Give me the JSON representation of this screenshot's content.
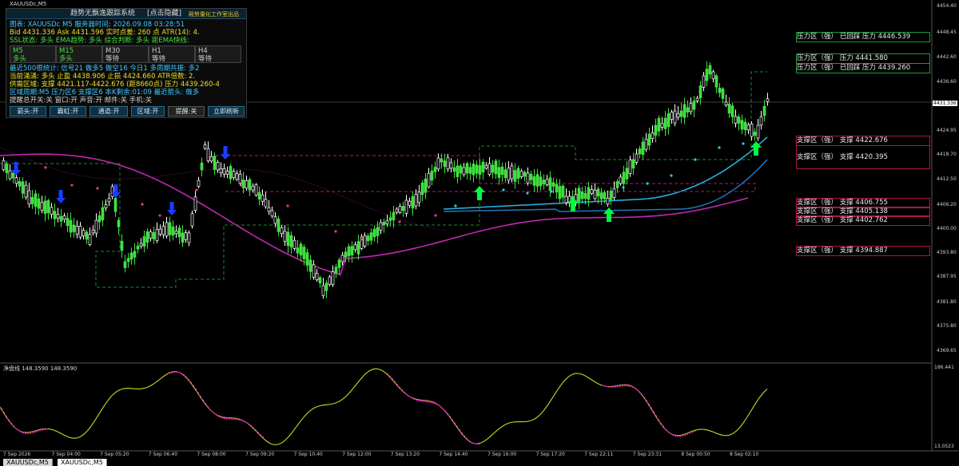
{
  "window": {
    "title": "XAUUSDc,M5"
  },
  "panel": {
    "title": "趋势无飘逸跟踪系统",
    "toggle": "[点击隐藏]",
    "brand": "殿势量化工作室出品",
    "lines": [
      {
        "text": "图表: XAUUSDc  M5   服务器时间: 2026.09.08 03:28:51",
        "color": "#3cc8ff"
      },
      {
        "text": "Bid 4431.336    Ask 4431.596    实时点差: 260 点    ATR(14): 4.",
        "color": "#e8e020"
      },
      {
        "text": "SSL状态: 多头    EMA趋势: 多头    综合判断: 多头    距EMA快线:",
        "color": "#40e040"
      }
    ],
    "timeframes": [
      {
        "name": "M5",
        "state": "多头",
        "color": "#40e040"
      },
      {
        "name": "M15",
        "state": "多头",
        "color": "#40e040"
      },
      {
        "name": "M30",
        "state": "等待",
        "color": "#d0d0d0"
      },
      {
        "name": "H1",
        "state": "等待",
        "color": "#d0d0d0"
      },
      {
        "name": "H4",
        "state": "等待",
        "color": "#d0d0d0"
      }
    ],
    "stats": [
      {
        "text": "最近500根统计: 信号21  做多5  做空16  今日1    多周期共振: 多2",
        "color": "#3cc8ff"
      },
      {
        "text": "当前涌涌: 多头    止盈 4438.906    止损 4424.660    ATR倍数: 2.",
        "color": "#e8e020"
      },
      {
        "text": "供需区域: 支撑 4421.117-4422.676  (距8660点)       压力 4439.260-4",
        "color": "#e8e020"
      },
      {
        "text": "区域周期:M5  压力区6  支撑区6  本K剩余:01:09    最近箭头: 做多",
        "color": "#3cc8ff"
      },
      {
        "text": "提醒总开关:关  窗口:开  声音:开  邮件:关  手机:关",
        "color": "#d0d0d0"
      }
    ],
    "buttons": [
      "箭头:开",
      "霸虹:开",
      "通道:开",
      "区域:开",
      "提醒:关",
      "立即刷新"
    ]
  },
  "zones": [
    {
      "label": "压力区（强）  已回踩    压力 4446.539",
      "type": "resistance"
    },
    {
      "label": "压力区（强）    压力 4441.580",
      "type": "resistance"
    },
    {
      "label": "压力区（强）  已回踩    压力 4439.260",
      "type": "resistance"
    },
    {
      "label": "支撑区（强）    支撑 4422.676",
      "type": "support"
    },
    {
      "label": "支撑区（强）    支撑 4420.395",
      "type": "support"
    },
    {
      "label": "支撑区（强）    支撑 4406.755",
      "type": "support"
    },
    {
      "label": "支撑区（强）    支撑 4405.138",
      "type": "support"
    },
    {
      "label": "支撑区（强）    支撑 4402.762",
      "type": "support"
    },
    {
      "label": "支撑区（强）    支撑 4394.887",
      "type": "support"
    }
  ],
  "price_axis": [
    "4454.40",
    "4448.45",
    "4442.60",
    "4436.60",
    "4431.336",
    "4424.95",
    "4418.70",
    "4412.50",
    "4406.20",
    "4400.00",
    "4393.80",
    "4387.95",
    "4381.80",
    "4375.80",
    "4369.65"
  ],
  "time_axis": [
    "7 Sep 2026",
    "7 Sep 04:00",
    "7 Sep 05:20",
    "7 Sep 06:40",
    "7 Sep 08:00",
    "7 Sep 09:20",
    "7 Sep 10:40",
    "7 Sep 12:00",
    "7 Sep 13:20",
    "7 Sep 14:40",
    "7 Sep 16:00",
    "7 Sep 17:20",
    "7 Sep 22:11",
    "7 Sep 23:31",
    "8 Sep 00:50",
    "8 Sep 02:10"
  ],
  "indicator": {
    "label": "净盘线 148.3590 148.3590",
    "top_value": "186.441",
    "bottom_value": "13.0523"
  },
  "tabs": [
    "XAUUSDc,M5",
    "XAUUSDc,M5"
  ],
  "colors": {
    "bull": "#40e040",
    "bear": "#ffffff",
    "ema_fast": "#1e90c8",
    "ema_slow": "#c028b0",
    "up_arrow": "#00ff40",
    "down_arrow": "#1a3cff"
  }
}
